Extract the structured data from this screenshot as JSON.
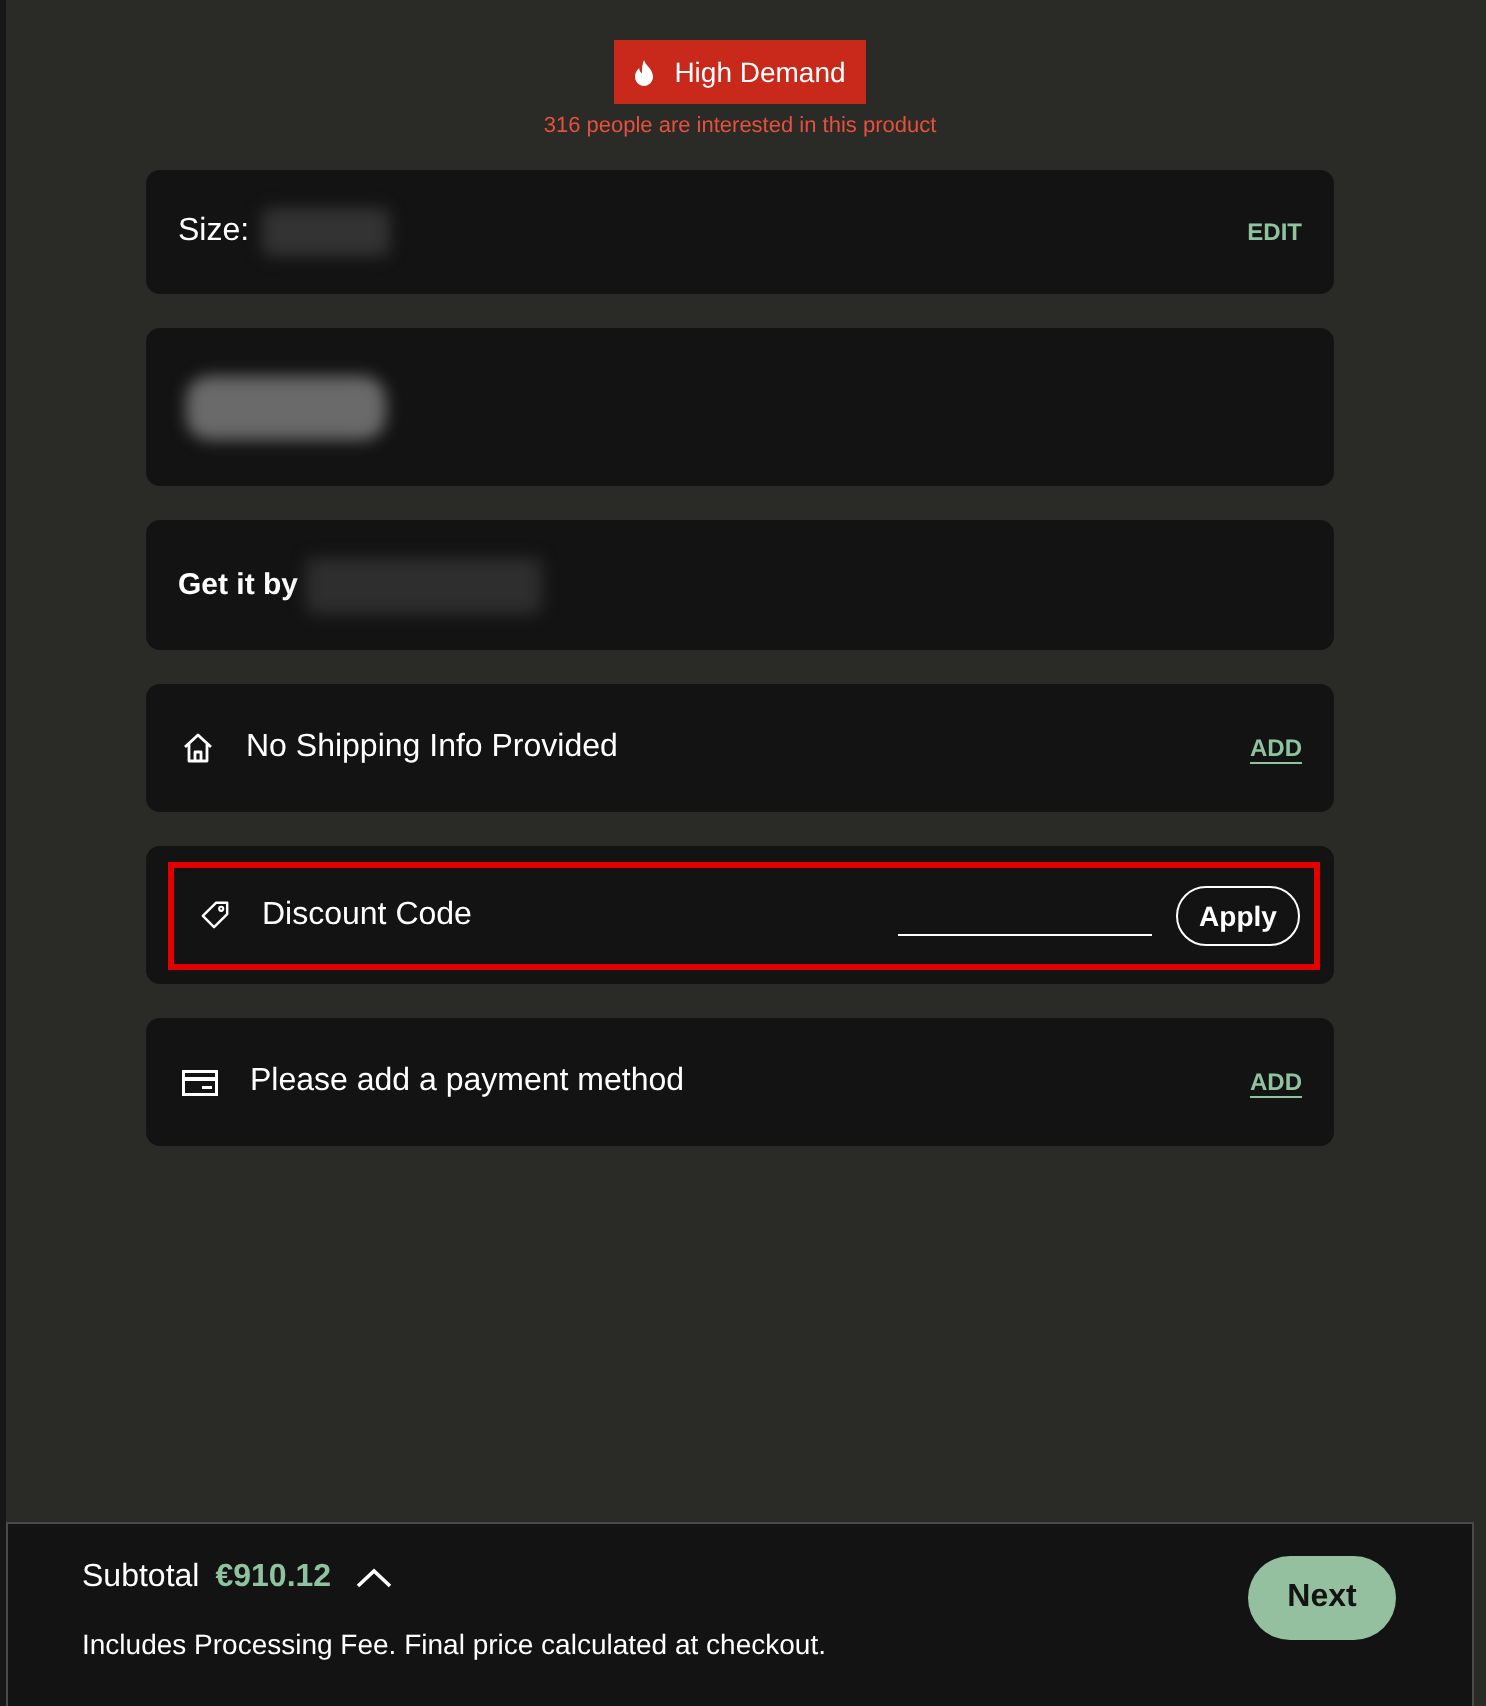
{
  "badge": {
    "label": "High Demand"
  },
  "interest_note": "316 people are interested in this product",
  "cards": [
    {
      "kind": "size",
      "label": "Size:",
      "action": "EDIT"
    },
    {
      "kind": "product"
    },
    {
      "kind": "delivery",
      "label": "Get it by"
    },
    {
      "kind": "shipping",
      "label": "No Shipping Info Provided",
      "action": "ADD"
    },
    {
      "kind": "discount",
      "label": "Discount Code",
      "button": "Apply",
      "highlighted": true
    },
    {
      "kind": "payment",
      "label": "Please add a payment method",
      "action": "ADD"
    }
  ],
  "footer": {
    "subtotal_label": "Subtotal",
    "subtotal_value": "€910.12",
    "note": "Includes Processing Fee. Final price calculated at checkout.",
    "next_button": "Next"
  }
}
